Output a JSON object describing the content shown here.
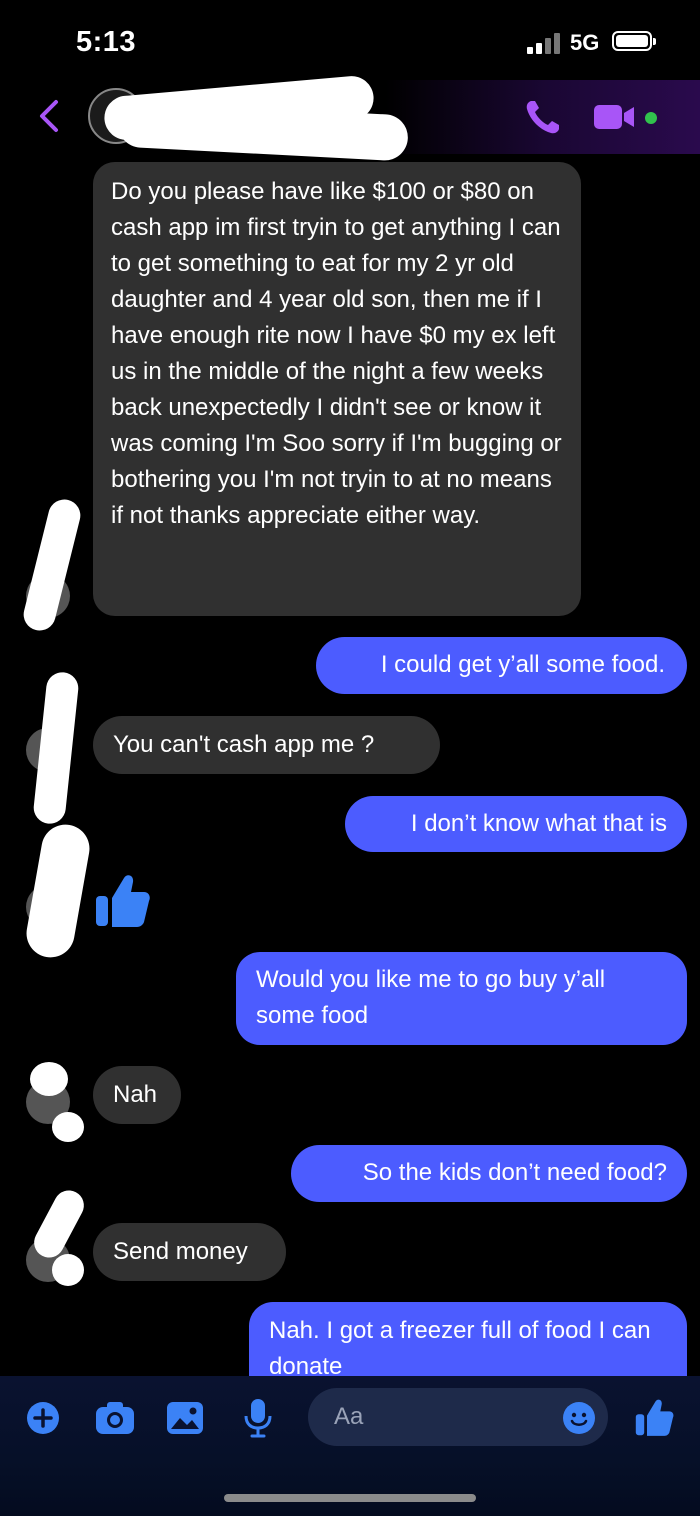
{
  "status_bar": {
    "time": "5:13",
    "network": "5G"
  },
  "header": {
    "contact_name": "",
    "actions": [
      "phone-icon",
      "video-camera-icon"
    ]
  },
  "messages": [
    {
      "direction": "incoming",
      "text": "Do you please have  like $100 or $80 on cash app im first tryin to get anything I can to get something to eat for my 2 yr old daughter and 4 year old son, then me if I have enough rite now I have $0 my ex left us in the middle of the night a few weeks back unexpectedly I didn't see or know it was coming I'm  Soo sorry  if I'm bugging or bothering you I'm not tryin to at  no means if not thanks  appreciate either way."
    },
    {
      "direction": "outgoing",
      "text": "I could get y’all some food."
    },
    {
      "direction": "incoming",
      "text": "You can't  cash app me ?"
    },
    {
      "direction": "outgoing",
      "text": "I don’t know what that is"
    },
    {
      "direction": "incoming",
      "type": "like",
      "icon": "thumbs-up-icon"
    },
    {
      "direction": "outgoing",
      "text": "Would you like me to go buy y’all some food"
    },
    {
      "direction": "incoming",
      "text": "Nah"
    },
    {
      "direction": "outgoing",
      "text": "So the kids don’t need food?"
    },
    {
      "direction": "incoming",
      "text": "Send money"
    },
    {
      "direction": "outgoing",
      "text": "Nah. I got a freezer full of food I can donate"
    }
  ],
  "composer": {
    "placeholder": "Aa",
    "icons": [
      "plus-icon",
      "camera-icon",
      "image-icon",
      "microphone-icon",
      "emoji-icon",
      "thumbs-up-icon"
    ]
  },
  "colors": {
    "outgoing_bubble": "#4c5cff",
    "incoming_bubble": "#303030",
    "accent": "#a855f7",
    "online": "#31c24d"
  }
}
